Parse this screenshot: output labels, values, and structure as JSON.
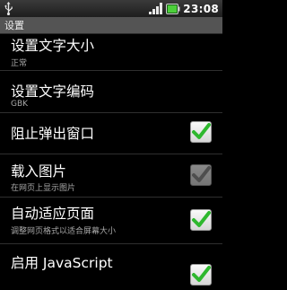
{
  "status_bar": {
    "time": "23:08",
    "icons": [
      "usb-icon",
      "signal-icon",
      "battery-icon"
    ]
  },
  "title_bar": {
    "title": "设置"
  },
  "colors": {
    "check_green": "#2eb82e",
    "check_gray": "#8e8e8e",
    "title_bar_bg": "#545454",
    "summary_text": "#a8a8a8"
  },
  "preferences": [
    {
      "title": "设置文字大小",
      "summary": "正常"
    },
    {
      "title": "设置文字编码",
      "summary": "GBK"
    },
    {
      "title": "阻止弹出窗口",
      "checked": true,
      "enabled": true
    },
    {
      "title": "载入图片",
      "summary": "在网页上显示图片",
      "checked": true,
      "enabled": false
    },
    {
      "title": "自动适应页面",
      "summary": "调整网页格式以适合屏幕大小",
      "checked": true,
      "enabled": true
    },
    {
      "title": "启用 JavaScript",
      "checked": true,
      "enabled": true
    }
  ]
}
